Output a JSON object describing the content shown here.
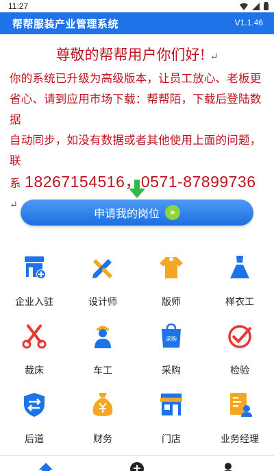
{
  "status_bar": {
    "time": "11:27"
  },
  "app_bar": {
    "title": "帮帮服装产业管理系统",
    "version": "V1.1.46"
  },
  "notice": {
    "title": "尊敬的帮帮用户你们好!",
    "line1": "你的系统已升级为高级版本，让员工放心、老板更",
    "line2": "省心、请到应用市场下载：帮帮陌，下载后登陆数据",
    "line3": "自动同步，如没有数据或者其他使用上面的问题，联",
    "line4_prefix": "系",
    "phones": "18267154516，0571-87899736",
    "return_mark": "↵"
  },
  "apply_button": {
    "label": "申请我的岗位",
    "chevron": "»"
  },
  "grid": [
    {
      "label": "企业入驻",
      "icon": "shop-add-icon"
    },
    {
      "label": "设计师",
      "icon": "pencil-ruler-icon"
    },
    {
      "label": "版师",
      "icon": "garment-icon"
    },
    {
      "label": "样衣工",
      "icon": "dress-icon"
    },
    {
      "label": "裁床",
      "icon": "scissors-icon"
    },
    {
      "label": "车工",
      "icon": "worker-icon"
    },
    {
      "label": "采购",
      "icon": "shopping-bag-icon"
    },
    {
      "label": "检验",
      "icon": "check-stamp-icon"
    },
    {
      "label": "后道",
      "icon": "shield-transfer-icon"
    },
    {
      "label": "财务",
      "icon": "money-bag-icon"
    },
    {
      "label": "门店",
      "icon": "storefront-icon"
    },
    {
      "label": "业务经理",
      "icon": "manager-doc-icon"
    }
  ],
  "bag_text": "采购",
  "colors": {
    "primary": "#1f73e8",
    "notice_red": "#c1121f",
    "accent_green": "#8fd43a",
    "orange": "#f5a623",
    "red": "#e53935"
  }
}
